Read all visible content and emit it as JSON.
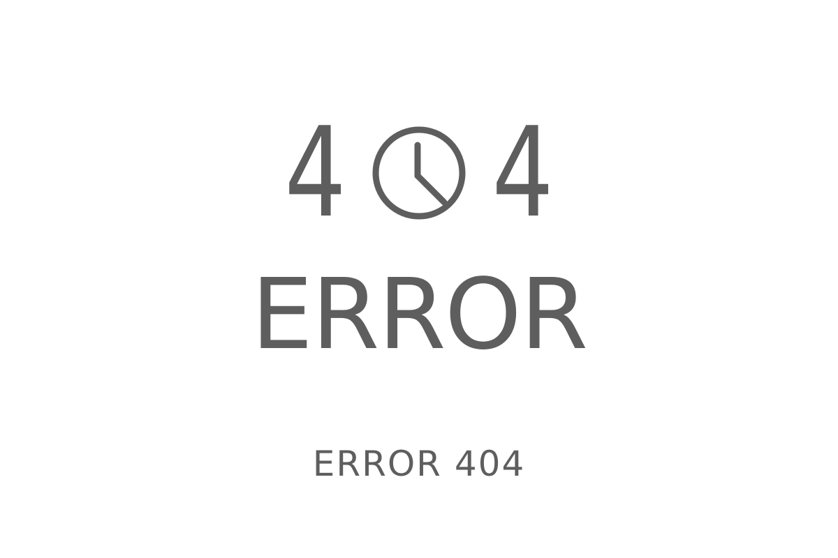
{
  "error_page": {
    "code_first_digit": "4",
    "code_last_digit": "4",
    "clock_icon": "clock-icon",
    "headline": "ERROR",
    "caption": "ERROR 404"
  },
  "colors": {
    "background": "#ffffff",
    "text": "#5e5e5e"
  }
}
